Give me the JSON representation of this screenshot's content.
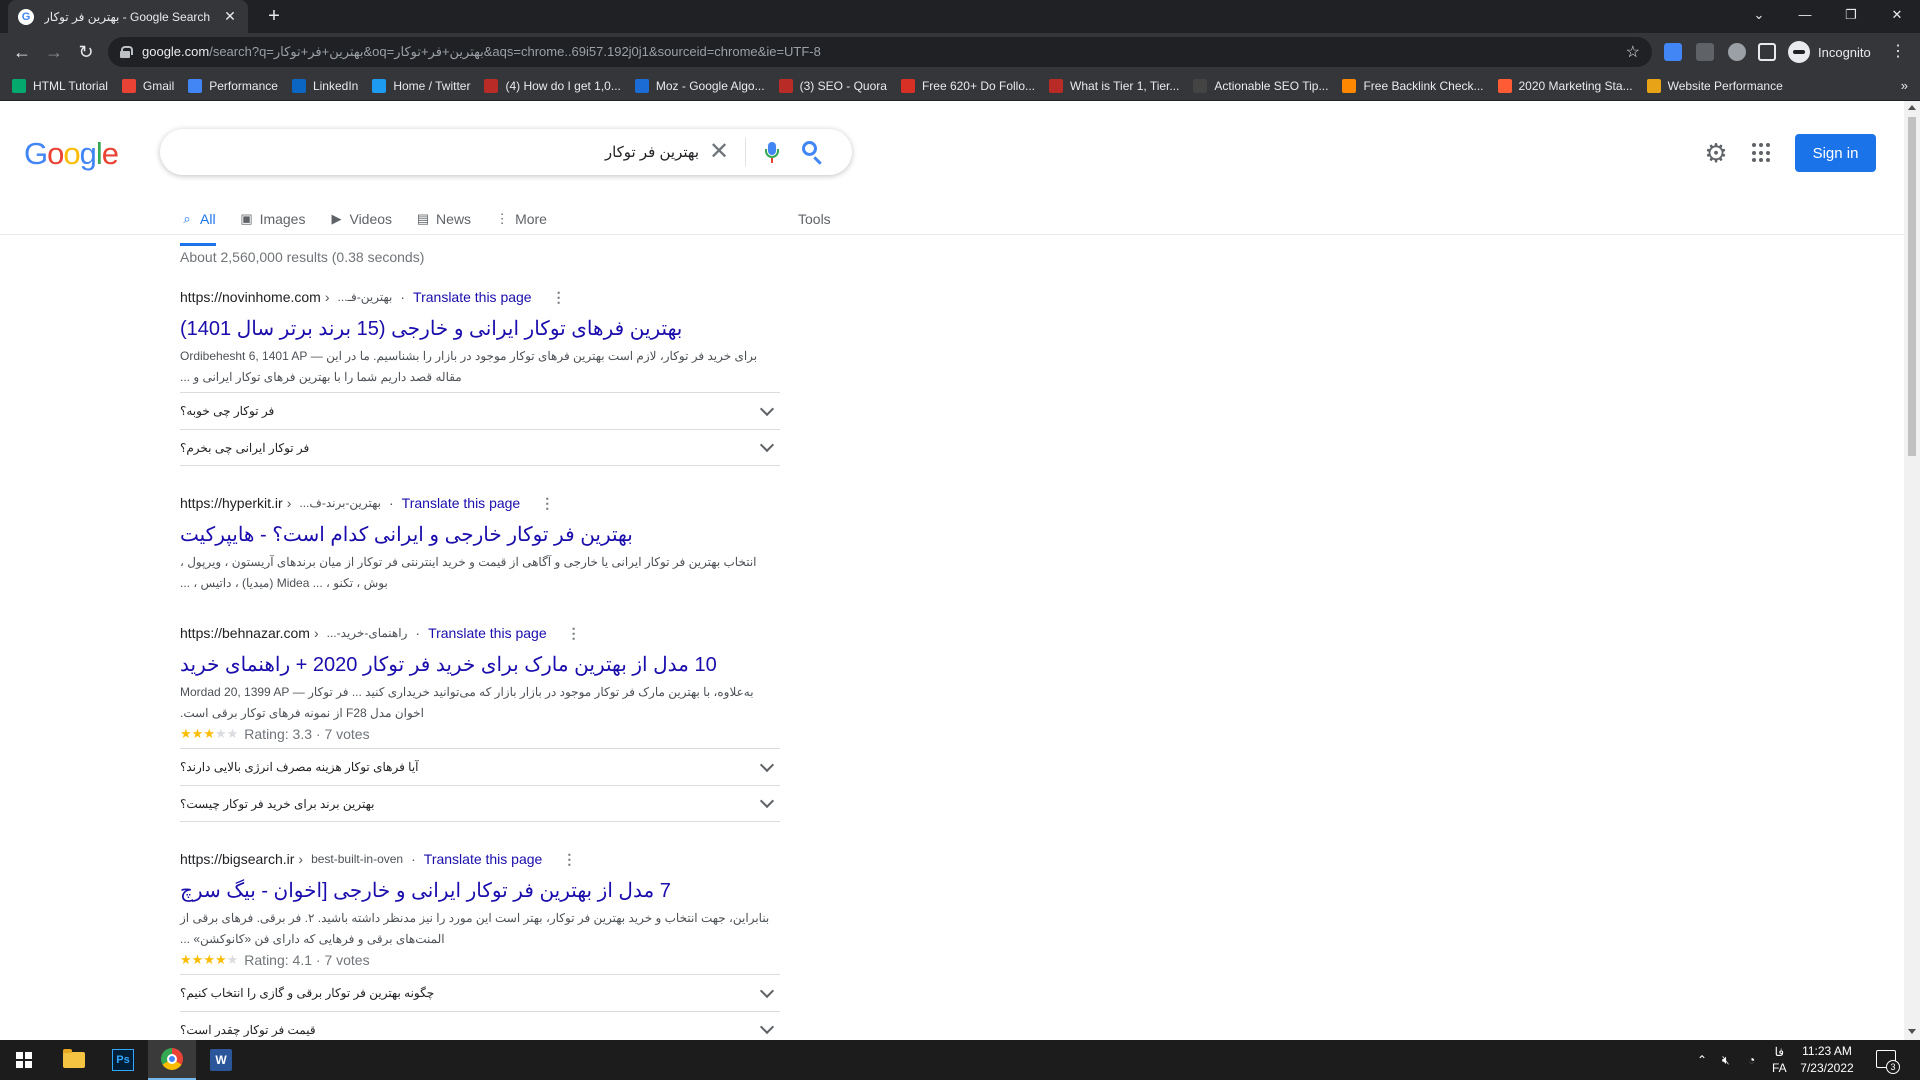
{
  "browser": {
    "tab": {
      "title": "بهترین فر توکار - Google Search",
      "favicon": "google-g-icon"
    },
    "url": {
      "host": "google.com",
      "path": "/search?q=بهترین+فر+توکار&oq=بهترین+فر+توکار&aqs=chrome..69i57.192j0j1&sourceid=chrome&ie=UTF-8"
    },
    "profile_label": "Incognito",
    "bookmarks": [
      {
        "label": "HTML Tutorial",
        "icon": "w3schools-icon",
        "color": "#04aa6d"
      },
      {
        "label": "Gmail",
        "icon": "gmail-icon",
        "color": "#ea4335"
      },
      {
        "label": "Performance",
        "icon": "performance-icon",
        "color": "#4285f4"
      },
      {
        "label": "LinkedIn",
        "icon": "linkedin-icon",
        "color": "#0a66c2"
      },
      {
        "label": "Home / Twitter",
        "icon": "twitter-icon",
        "color": "#1d9bf0"
      },
      {
        "label": "(4) How do I get 1,0...",
        "icon": "quora-icon",
        "color": "#b92b27"
      },
      {
        "label": "Moz - Google Algo...",
        "icon": "moz-icon",
        "color": "#1b6cd5"
      },
      {
        "label": "(3) SEO - Quora",
        "icon": "quora-icon",
        "color": "#b92b27"
      },
      {
        "label": "Free 620+ Do Follo...",
        "icon": "site-icon",
        "color": "#d93025"
      },
      {
        "label": "What is Tier 1, Tier...",
        "icon": "quora-icon",
        "color": "#b92b27"
      },
      {
        "label": "Actionable SEO Tip...",
        "icon": "se-icon",
        "color": "#444444"
      },
      {
        "label": "Free Backlink Check...",
        "icon": "ahrefs-icon",
        "color": "#ff8800"
      },
      {
        "label": "2020 Marketing Sta...",
        "icon": "hubspot-icon",
        "color": "#ff5c35"
      },
      {
        "label": "Website Performance",
        "icon": "gtmetrix-icon",
        "color": "#e8a317"
      }
    ]
  },
  "google": {
    "logo": "Google",
    "search": {
      "query": "بهترین فر توکار"
    },
    "sign_in_label": "Sign in",
    "tabs": [
      {
        "label": "All",
        "icon": "search-icon"
      },
      {
        "label": "Images",
        "icon": "image-icon"
      },
      {
        "label": "Videos",
        "icon": "video-icon"
      },
      {
        "label": "News",
        "icon": "news-icon"
      },
      {
        "label": "More",
        "icon": "more-vert-icon"
      }
    ],
    "tools_label": "Tools",
    "stats": "About 2,560,000 results (0.38 seconds)",
    "translate_label": "Translate this page",
    "results": [
      {
        "host": "https://novinhome.com",
        "path": "بهترین-فـ...",
        "title": "بهترین فرهای توکار ایرانی و خارجی (15 برند برتر سال 1401)",
        "snippet": "برای خرید فر توکار، لازم است بهترین فرهای توکار موجود در بازار را بشناسیم. ما در این — Ordibehesht 6, 1401 AP مقاله قصد داریم شما را با بهترین فرهای توکار ایرانی و ...",
        "faqs": [
          "فر توکار چی خوبه؟",
          "فر توکار ایرانی چی بخرم؟"
        ]
      },
      {
        "host": "https://hyperkit.ir",
        "path": "بهترین-برند-ف...",
        "title": "بهترین فر توکار خارجی و ایرانی کدام است؟ - هایپرکیت",
        "snippet": "انتخاب بهترین فر توکار ایرانی یا خارجی و آگاهی از قیمت و خرید اینترنتی فر توکار از میان برندهای آریستون ، ویرپول ، بوش ، تکنو ، ... Midea (میدیا) ، داتیس ، ...",
        "faqs": []
      },
      {
        "host": "https://behnazar.com",
        "path": "راهنمای-خرید-...",
        "title": "10 مدل از بهترین مارک برای خرید فر توکار 2020 + راهنمای خرید",
        "snippet": "به‌علاوه، با بهترین مارک فر توکار موجود در بازار بازار که می‌توانید خریداری کنید ... فر توکار — Mordad 20, 1399 AP اخوان مدل F28 از نمونه فرهای توکار برقی است.",
        "rating": 3.3,
        "rating_label": "Rating: 3.3",
        "votes": "7 votes",
        "faqs": [
          "آیا فرهای توکار هزینه مصرف انرژی بالایی دارند؟",
          "بهترین برند برای خرید فر توکار چیست؟"
        ]
      },
      {
        "host": "https://bigsearch.ir",
        "path": "best-built-in-oven",
        "title": "7 مدل از بهترین فر توکار ایرانی و خارجی [اخوان - بیگ سرچ",
        "snippet": "بنابراین، جهت انتخاب و خرید بهترین فر توکار، بهتر است این مورد را نیز مدنظر داشته باشید. ۲. فر برقی. فرهای برقی از المنت‌های برقی و فرهایی که دارای فن «کانوکشن» ...",
        "rating": 4.1,
        "rating_label": "Rating: 4.1",
        "votes": "7 votes",
        "faqs": [
          "چگونه بهترین فر توکار برقی و گازی را انتخاب کنیم؟",
          "قیمت فر توکار چقدر است؟"
        ]
      }
    ]
  },
  "taskbar": {
    "apps": [
      {
        "name": "start",
        "icon": "windows-icon"
      },
      {
        "name": "file-explorer",
        "icon": "folder-icon"
      },
      {
        "name": "photoshop",
        "icon": "photoshop-icon",
        "label": "Ps"
      },
      {
        "name": "chrome",
        "icon": "chrome-icon",
        "active": true
      },
      {
        "name": "word",
        "icon": "word-icon",
        "label": "W"
      }
    ],
    "language_top": "فا",
    "language_bottom": "FA",
    "time": "11:23 AM",
    "date": "7/23/2022",
    "notifications": "3"
  }
}
